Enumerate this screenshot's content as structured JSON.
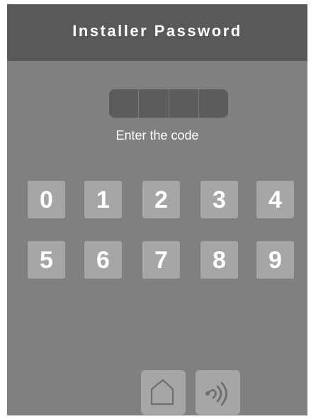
{
  "header": {
    "title": "Installer Password"
  },
  "code": {
    "digits_entered": 0,
    "length": 4
  },
  "prompt": "Enter the code",
  "keypad": {
    "keys": [
      "0",
      "1",
      "2",
      "3",
      "4",
      "5",
      "6",
      "7",
      "8",
      "9"
    ]
  },
  "bottom_bar": {
    "buttons": [
      "home-icon",
      "contactless-icon"
    ]
  },
  "colors": {
    "background": "#808080",
    "title_bar": "#595959",
    "key": "#a6a6a6",
    "code_field": "#5c5c5c",
    "text": "#ffffff"
  }
}
